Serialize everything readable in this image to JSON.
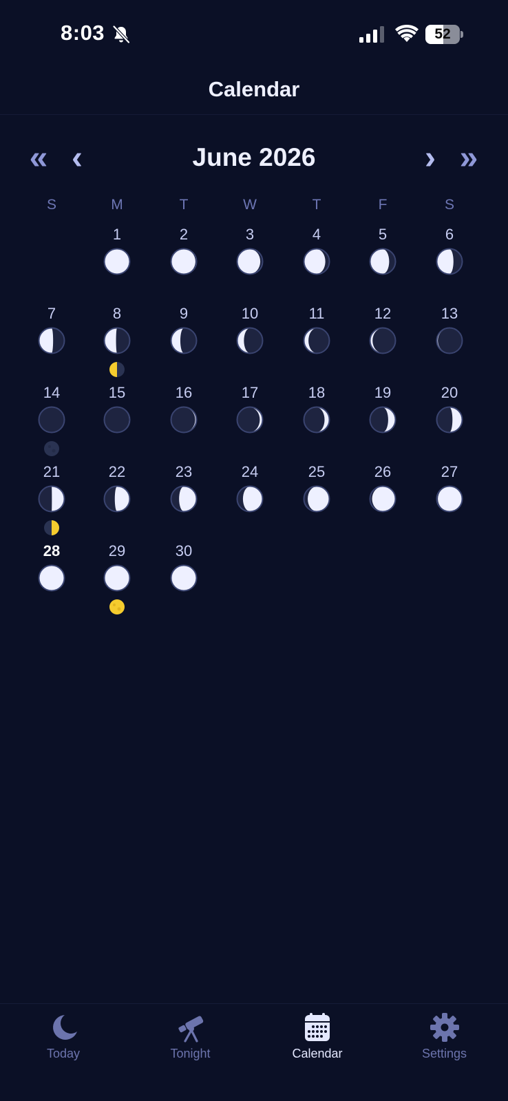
{
  "status_bar": {
    "time": "8:03",
    "battery_level": "52",
    "battery_fraction": 0.52,
    "icons": [
      "bell-slash-icon",
      "cellular-signal-icon",
      "wifi-icon",
      "battery-icon"
    ]
  },
  "header": {
    "title": "Calendar"
  },
  "month_nav": {
    "title": "June 2026",
    "prev_year_glyph": "«",
    "prev_month_glyph": "‹",
    "next_month_glyph": "›",
    "next_year_glyph": "»"
  },
  "weekdays": [
    "S",
    "M",
    "T",
    "W",
    "T",
    "F",
    "S"
  ],
  "first_weekday_offset": 1,
  "days": [
    {
      "label": "1",
      "illum": 0.99,
      "waxing": false
    },
    {
      "label": "2",
      "illum": 0.97,
      "waxing": false
    },
    {
      "label": "3",
      "illum": 0.92,
      "waxing": false
    },
    {
      "label": "4",
      "illum": 0.85,
      "waxing": false
    },
    {
      "label": "5",
      "illum": 0.76,
      "waxing": false
    },
    {
      "label": "6",
      "illum": 0.66,
      "waxing": false
    },
    {
      "label": "7",
      "illum": 0.56,
      "waxing": false
    },
    {
      "label": "8",
      "illum": 0.46,
      "waxing": false,
      "event": "last-quarter-icon"
    },
    {
      "label": "9",
      "illum": 0.36,
      "waxing": false
    },
    {
      "label": "10",
      "illum": 0.26,
      "waxing": false
    },
    {
      "label": "11",
      "illum": 0.17,
      "waxing": false
    },
    {
      "label": "12",
      "illum": 0.09,
      "waxing": false
    },
    {
      "label": "13",
      "illum": 0.03,
      "waxing": false
    },
    {
      "label": "14",
      "illum": 0.0,
      "waxing": false,
      "event": "new-moon-icon"
    },
    {
      "label": "15",
      "illum": 0.01,
      "waxing": true
    },
    {
      "label": "16",
      "illum": 0.04,
      "waxing": true
    },
    {
      "label": "17",
      "illum": 0.1,
      "waxing": true
    },
    {
      "label": "18",
      "illum": 0.18,
      "waxing": true
    },
    {
      "label": "19",
      "illum": 0.28,
      "waxing": true
    },
    {
      "label": "20",
      "illum": 0.38,
      "waxing": true
    },
    {
      "label": "21",
      "illum": 0.49,
      "waxing": true,
      "event": "first-quarter-icon"
    },
    {
      "label": "22",
      "illum": 0.59,
      "waxing": true
    },
    {
      "label": "23",
      "illum": 0.69,
      "waxing": true
    },
    {
      "label": "24",
      "illum": 0.78,
      "waxing": true
    },
    {
      "label": "25",
      "illum": 0.86,
      "waxing": true
    },
    {
      "label": "26",
      "illum": 0.93,
      "waxing": true
    },
    {
      "label": "27",
      "illum": 0.97,
      "waxing": true
    },
    {
      "label": "28",
      "illum": 0.99,
      "waxing": true,
      "today": true
    },
    {
      "label": "29",
      "illum": 1.0,
      "waxing": true,
      "event": "full-moon-icon"
    },
    {
      "label": "30",
      "illum": 0.99,
      "waxing": false
    }
  ],
  "tabs": [
    {
      "label": "Today",
      "icon": "moon-icon",
      "active": false
    },
    {
      "label": "Tonight",
      "icon": "telescope-icon",
      "active": false
    },
    {
      "label": "Calendar",
      "icon": "calendar-icon",
      "active": true
    },
    {
      "label": "Settings",
      "icon": "gear-icon",
      "active": false
    }
  ],
  "colors": {
    "background": "#0b1026",
    "moon_lit": "#eef0ff",
    "moon_dark": "#1e2440",
    "moon_rim": "#3a4470",
    "event_gold": "#f5cc2e",
    "tab_inactive": "#6c74ad",
    "tab_active": "#e4e8ff"
  }
}
